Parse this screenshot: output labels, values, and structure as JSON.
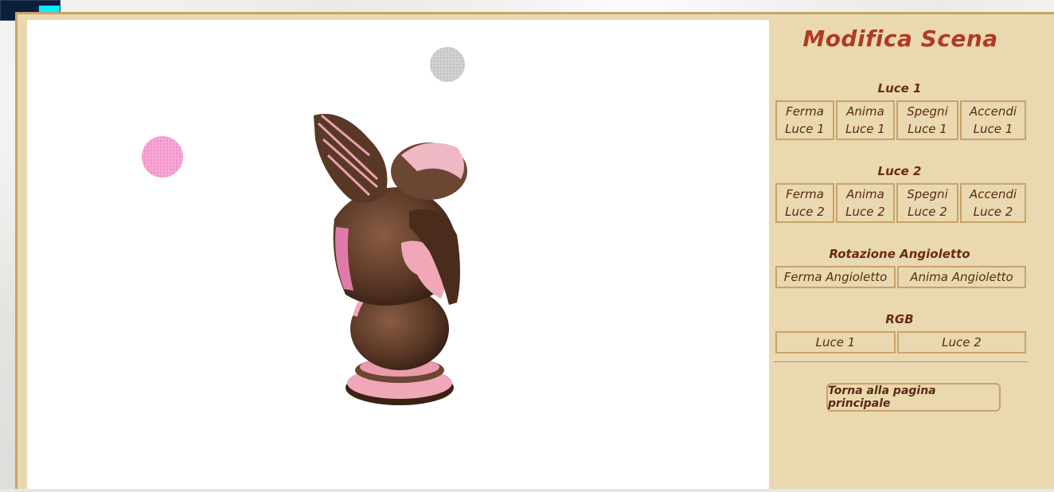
{
  "panel": {
    "title": "Modifica Scena",
    "sections": [
      {
        "label": "Luce 1",
        "buttons": [
          {
            "line1": "Ferma",
            "line2": "Luce 1"
          },
          {
            "line1": "Anima",
            "line2": "Luce 1"
          },
          {
            "line1": "Spegni",
            "line2": "Luce 1"
          },
          {
            "line1": "Accendi",
            "line2": "Luce 1"
          }
        ]
      },
      {
        "label": "Luce 2",
        "buttons": [
          {
            "line1": "Ferma",
            "line2": "Luce 2"
          },
          {
            "line1": "Anima",
            "line2": "Luce 2"
          },
          {
            "line1": "Spegni",
            "line2": "Luce 2"
          },
          {
            "line1": "Accendi",
            "line2": "Luce 2"
          }
        ]
      },
      {
        "label": "Rotazione Angioletto",
        "buttons": [
          {
            "label": "Ferma Angioletto"
          },
          {
            "label": "Anima Angioletto"
          }
        ]
      },
      {
        "label": "RGB",
        "buttons": [
          {
            "label": "Luce 1"
          },
          {
            "label": "Luce 2"
          }
        ]
      }
    ],
    "back_button": "Torna alla pagina principale"
  },
  "colors": {
    "title": "#b23a22",
    "panel_bg": "#ead9b0",
    "button_border": "#c9a26a",
    "button_text": "#5a2a15",
    "light_1_sphere": "#f48fc8",
    "light_2_sphere": "#c8c8c8",
    "statue_body": "#6b4632",
    "statue_highlight": "#f0a8b8"
  },
  "scene": {
    "objects": [
      "pink-light-sphere",
      "gray-light-sphere",
      "angel-statue"
    ]
  }
}
